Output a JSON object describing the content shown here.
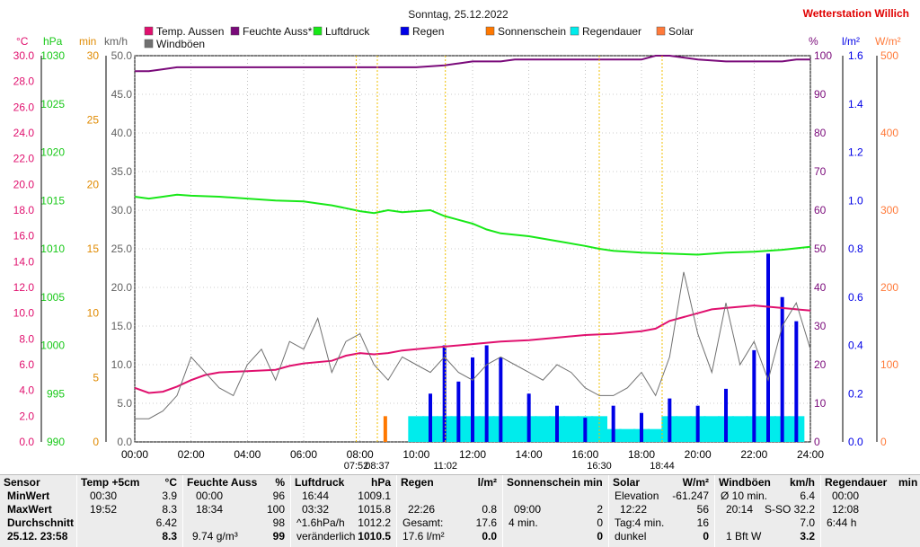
{
  "title": "Sonntag, 25.12.2022",
  "station": "Wetterstation Willich",
  "legend": [
    {
      "label": "Temp. Aussen",
      "color": "#e0106e"
    },
    {
      "label": "Feuchte Auss*",
      "color": "#7a0a7a"
    },
    {
      "label": "Luftdruck",
      "color": "#18e818"
    },
    {
      "label": "Regen",
      "color": "#0000e6"
    },
    {
      "label": "Sonnenschein",
      "color": "#ff7800"
    },
    {
      "label": "Regendauer",
      "color": "#00ecec"
    },
    {
      "label": "Solar",
      "color": "#ff7a3a"
    },
    {
      "label": "Windböen",
      "color": "#707070"
    }
  ],
  "axes": {
    "temp": {
      "unit": "°C",
      "color": "#e0106e",
      "ticks": [
        "30.0",
        "28.0",
        "26.0",
        "24.0",
        "22.0",
        "20.0",
        "18.0",
        "16.0",
        "14.0",
        "12.0",
        "10.0",
        "8.0",
        "6.0",
        "4.0",
        "2.0",
        "0.0"
      ]
    },
    "press": {
      "unit": "hPa",
      "color": "#18c818",
      "ticks": [
        "1030",
        "1025",
        "1020",
        "1015",
        "1010",
        "1005",
        "1000",
        "995",
        "990"
      ]
    },
    "min": {
      "unit": "min",
      "color": "#e08a00",
      "ticks": [
        "30",
        "25",
        "20",
        "15",
        "10",
        "5",
        "0"
      ]
    },
    "wind": {
      "unit": "km/h",
      "color": "#606060",
      "ticks": [
        "50.0",
        "45.0",
        "40.0",
        "35.0",
        "30.0",
        "25.0",
        "20.0",
        "15.0",
        "10.0",
        "5.0",
        "0.0"
      ]
    },
    "hum": {
      "unit": "%",
      "color": "#7a0a7a",
      "ticks": [
        "100",
        "90",
        "80",
        "70",
        "60",
        "50",
        "40",
        "30",
        "20",
        "10",
        "0"
      ]
    },
    "rain": {
      "unit": "l/m²",
      "color": "#0000e6",
      "ticks": [
        "1.6",
        "1.4",
        "1.2",
        "1.0",
        "0.8",
        "0.6",
        "0.4",
        "0.2",
        "0.0"
      ]
    },
    "solar": {
      "unit": "W/m²",
      "color": "#ff7a3a",
      "ticks": [
        "500",
        "400",
        "300",
        "200",
        "100",
        "0"
      ]
    }
  },
  "chart_data": {
    "type": "line",
    "x_ticks": [
      "00:00",
      "02:00",
      "04:00",
      "06:00",
      "08:00",
      "10:00",
      "12:00",
      "14:00",
      "16:00",
      "18:00",
      "20:00",
      "22:00",
      "24:00"
    ],
    "x_range_hours": [
      0,
      24
    ],
    "grid": true,
    "series": [
      {
        "name": "Temp. Aussen",
        "axis": "temp",
        "color": "#e0106e",
        "x": [
          0,
          0.5,
          1,
          1.5,
          2,
          2.5,
          3,
          4,
          5,
          5.5,
          6,
          7,
          7.5,
          8,
          8.5,
          9,
          9.5,
          10,
          11,
          12,
          13,
          14,
          15,
          16,
          17,
          18,
          18.5,
          19,
          19.5,
          20,
          20.5,
          21,
          22,
          23,
          24
        ],
        "y": [
          4.2,
          3.8,
          3.9,
          4.3,
          4.8,
          5.2,
          5.4,
          5.5,
          5.6,
          5.9,
          6.1,
          6.3,
          6.7,
          6.9,
          6.8,
          6.9,
          7.1,
          7.2,
          7.4,
          7.6,
          7.8,
          7.9,
          8.1,
          8.3,
          8.4,
          8.6,
          8.8,
          9.4,
          9.7,
          10.0,
          10.3,
          10.4,
          10.6,
          10.4,
          10.2
        ]
      },
      {
        "name": "Feuchte Auss*",
        "axis": "hum",
        "color": "#7a0a7a",
        "x": [
          0,
          0.5,
          1,
          1.5,
          2,
          4,
          6,
          8,
          10,
          11,
          11.5,
          12,
          12.5,
          13,
          13.5,
          14,
          16,
          18,
          18.5,
          19,
          19.5,
          20,
          21,
          22,
          23,
          23.5,
          24
        ],
        "y": [
          96,
          96,
          96.5,
          97,
          97,
          97,
          97,
          97,
          97,
          97.5,
          98,
          98.5,
          98.5,
          98.5,
          99,
          99,
          99,
          99,
          100,
          100,
          99.5,
          99,
          98.5,
          98.5,
          98.5,
          99,
          99
        ]
      },
      {
        "name": "Luftdruck",
        "axis": "press",
        "color": "#18e818",
        "x": [
          0,
          0.5,
          1,
          1.5,
          2,
          3,
          4,
          5,
          6,
          6.5,
          7,
          7.5,
          8,
          8.5,
          9,
          9.5,
          10,
          10.5,
          11,
          12,
          12.5,
          13,
          14,
          15,
          16,
          16.5,
          17,
          18,
          19,
          20,
          21,
          22,
          23,
          24
        ],
        "y": [
          1015.4,
          1015.2,
          1015.4,
          1015.6,
          1015.5,
          1015.4,
          1015.2,
          1015.0,
          1014.9,
          1014.7,
          1014.5,
          1014.2,
          1013.9,
          1013.7,
          1014.0,
          1013.8,
          1013.9,
          1014.0,
          1013.4,
          1012.6,
          1012.0,
          1011.6,
          1011.3,
          1010.8,
          1010.3,
          1010.0,
          1009.8,
          1009.6,
          1009.5,
          1009.4,
          1009.6,
          1009.7,
          1009.9,
          1010.2
        ]
      },
      {
        "name": "Windböen",
        "axis": "wind",
        "color": "#707070",
        "x": [
          0,
          0.5,
          1,
          1.5,
          2,
          2.5,
          3,
          3.5,
          4,
          4.5,
          5,
          5.5,
          6,
          6.5,
          7,
          7.5,
          8,
          8.5,
          9,
          9.5,
          10,
          10.5,
          11,
          11.5,
          12,
          12.5,
          13,
          13.5,
          14,
          14.5,
          15,
          15.5,
          16,
          16.5,
          17,
          17.5,
          18,
          18.5,
          19,
          19.5,
          20,
          20.5,
          21,
          21.5,
          22,
          22.5,
          23,
          23.5,
          24
        ],
        "y": [
          3,
          3,
          4,
          6,
          11,
          9,
          7,
          6,
          10,
          12,
          8,
          13,
          12,
          16,
          9,
          13,
          14,
          10,
          8,
          11,
          10,
          9,
          11,
          9,
          8,
          10,
          11,
          10,
          9,
          8,
          10,
          9,
          7,
          6,
          6,
          7,
          9,
          6,
          11,
          22,
          14,
          9,
          18,
          10,
          13,
          8,
          15,
          18,
          12
        ]
      }
    ],
    "bars": [
      {
        "name": "Regen",
        "axis": "rain",
        "color": "#0000e6",
        "x": [
          10.5,
          11,
          11.5,
          12,
          12.5,
          13,
          14,
          15,
          16,
          17,
          18,
          19,
          20,
          21,
          22,
          22.5,
          23,
          23.5
        ],
        "values": [
          0.2,
          0.4,
          0.25,
          0.35,
          0.4,
          0.35,
          0.2,
          0.15,
          0.1,
          0.15,
          0.12,
          0.18,
          0.15,
          0.22,
          0.38,
          0.78,
          0.6,
          0.5
        ]
      },
      {
        "name": "Regendauer",
        "axis": "min",
        "color": "#00ecec",
        "x": [
          10,
          10.5,
          11,
          11.5,
          12,
          12.5,
          13,
          13.5,
          14,
          14.5,
          15,
          15.5,
          16,
          16.5,
          17,
          17.5,
          18,
          18.5,
          19,
          19.5,
          20,
          20.5,
          21,
          21.5,
          22,
          22.5,
          23,
          23.5
        ],
        "values": [
          2,
          2,
          2,
          2,
          2,
          2,
          2,
          2,
          2,
          2,
          2,
          2,
          2,
          2,
          1,
          1,
          1,
          1,
          2,
          2,
          2,
          2,
          2,
          2,
          2,
          2,
          2,
          2
        ]
      },
      {
        "name": "Sonnenschein",
        "axis": "min",
        "color": "#ff7800",
        "x": [
          8.9
        ],
        "values": [
          2
        ]
      }
    ]
  },
  "markers": [
    {
      "time": "07:52",
      "label": "07:52"
    },
    {
      "time": "08:37",
      "label": "08:37"
    },
    {
      "time": "11:02",
      "label": "11:02"
    },
    {
      "time": "16:30",
      "label": "16:30"
    },
    {
      "time": "18:44",
      "label": "18:44"
    }
  ],
  "table": {
    "sensor": {
      "header": "Sensor",
      "rows": [
        "MinWert",
        "MaxWert",
        "Durchschnitt",
        "25.12. 23:58"
      ]
    },
    "temp": {
      "header": "Temp +5cm",
      "unit": "°C",
      "rows": [
        [
          "00:30",
          "3.9"
        ],
        [
          "19:52",
          "8.3"
        ],
        [
          "",
          "6.42"
        ],
        [
          "",
          "8.3"
        ]
      ]
    },
    "feuchte": {
      "header": "Feuchte Auss",
      "unit": "%",
      "rows": [
        [
          "00:00",
          "96"
        ],
        [
          "18:34",
          "100"
        ],
        [
          "",
          "98"
        ],
        [
          "9.74 g/m³",
          "99"
        ]
      ]
    },
    "luftdruck": {
      "header": "Luftdruck",
      "unit": "hPa",
      "rows": [
        [
          "16:44",
          "1009.1"
        ],
        [
          "03:32",
          "1015.8"
        ],
        [
          "^1.6hPa/h",
          "1012.2"
        ],
        [
          "veränderlich",
          "1010.5"
        ]
      ]
    },
    "regen": {
      "header": "Regen",
      "unit": "l/m²",
      "rows": [
        [
          "",
          ""
        ],
        [
          "22:26",
          "0.8"
        ],
        [
          "Gesamt:",
          "17.6"
        ],
        [
          "17.6 l/m²",
          "0.0"
        ]
      ]
    },
    "sonne": {
      "header": "Sonnenschein min",
      "unit": "",
      "rows": [
        [
          "",
          ""
        ],
        [
          "09:00",
          "2"
        ],
        [
          "4 min.",
          "0"
        ],
        [
          "",
          "0"
        ]
      ]
    },
    "solar": {
      "header": "Solar",
      "unit": "W/m²",
      "rows": [
        [
          "Elevation",
          "-61.247"
        ],
        [
          "12:22",
          "56"
        ],
        [
          "Tag:4 min.",
          "16"
        ],
        [
          "dunkel",
          "0"
        ]
      ]
    },
    "wind": {
      "header": "Windböen",
      "unit": "km/h",
      "rows": [
        [
          "Ø 10 min.",
          "6.4"
        ],
        [
          "20:14",
          "S-SO 32.2"
        ],
        [
          "",
          "7.0"
        ],
        [
          "1 Bft W",
          "3.2"
        ]
      ]
    },
    "regendauer": {
      "header": "Regendauer",
      "unit": "min",
      "rows": [
        [
          "00:00",
          ""
        ],
        [
          "12:08",
          ""
        ],
        [
          "6:44 h",
          ""
        ],
        [
          "",
          ""
        ]
      ]
    }
  }
}
